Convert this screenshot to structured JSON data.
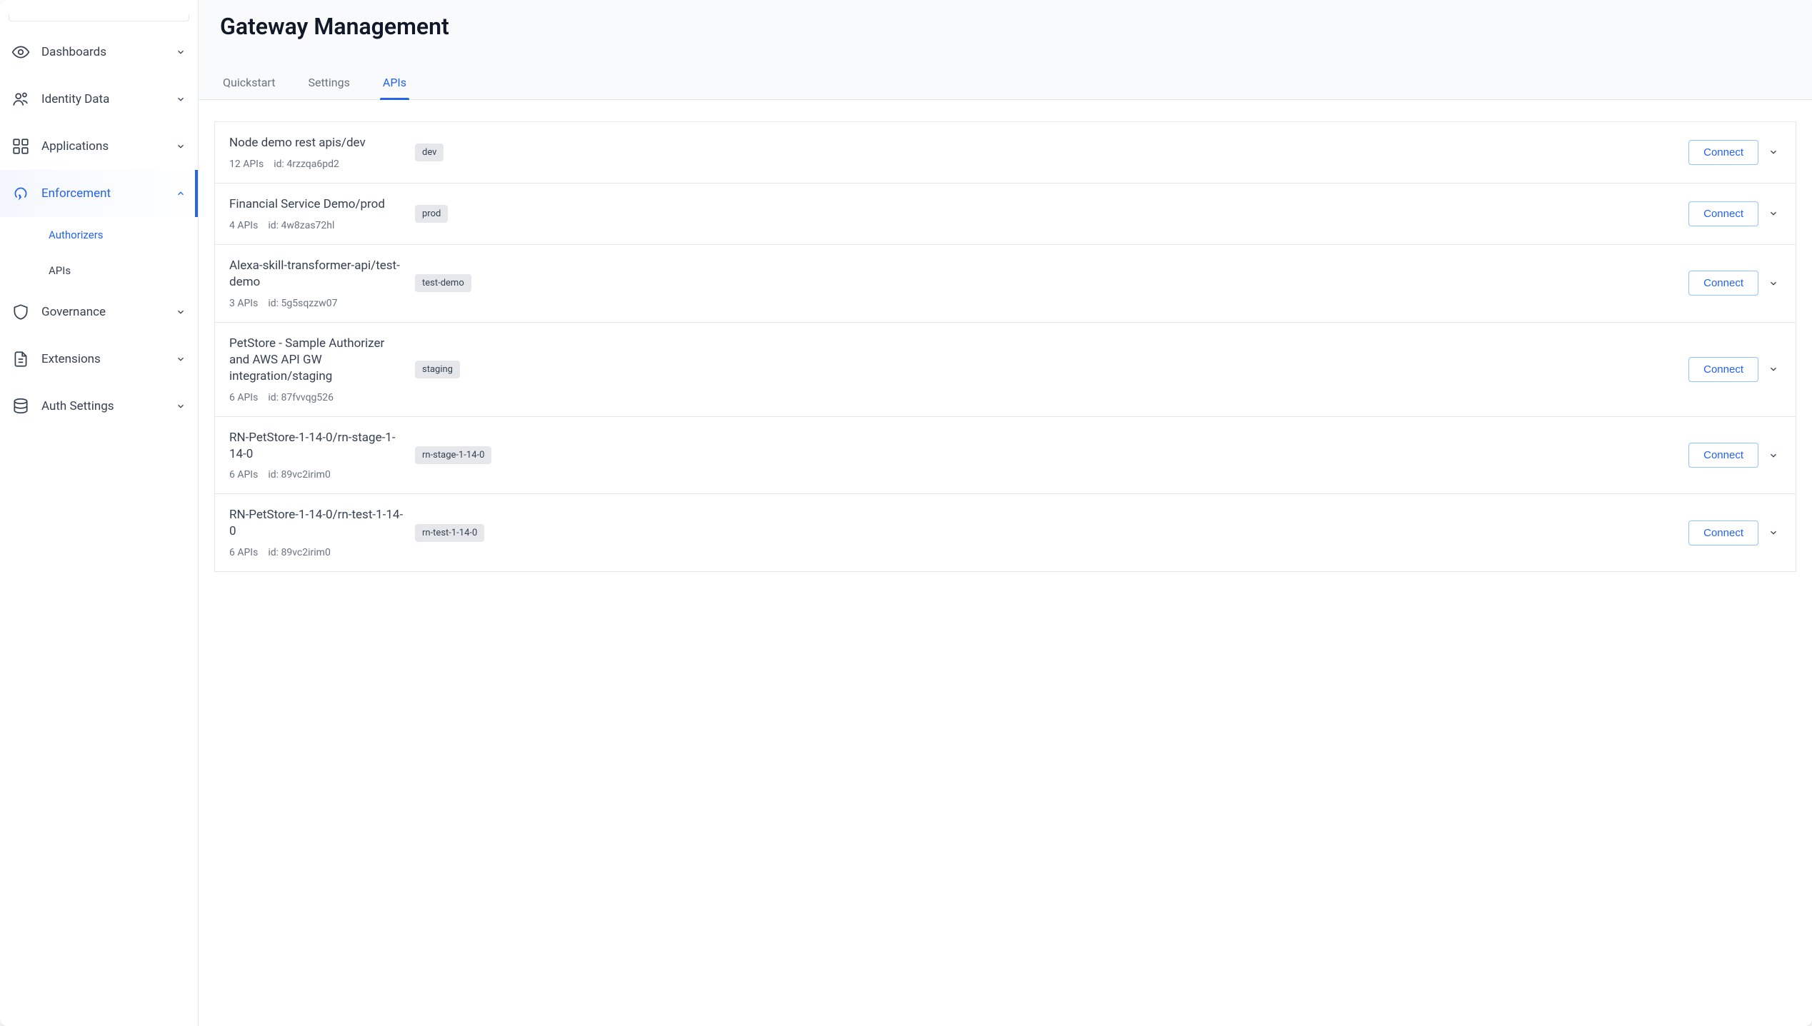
{
  "sidebar": {
    "items": [
      {
        "key": "dashboards",
        "label": "Dashboards",
        "icon": "eye",
        "expanded": false,
        "active": false
      },
      {
        "key": "identity",
        "label": "Identity Data",
        "icon": "identity",
        "expanded": false,
        "active": false
      },
      {
        "key": "applications",
        "label": "Applications",
        "icon": "apps",
        "expanded": false,
        "active": false
      },
      {
        "key": "enforcement",
        "label": "Enforcement",
        "icon": "enforcement",
        "expanded": true,
        "active": true,
        "children": [
          {
            "key": "authorizers",
            "label": "Authorizers",
            "active": true
          },
          {
            "key": "apis",
            "label": "APIs",
            "active": false
          }
        ]
      },
      {
        "key": "governance",
        "label": "Governance",
        "icon": "shield",
        "expanded": false,
        "active": false
      },
      {
        "key": "extensions",
        "label": "Extensions",
        "icon": "document",
        "expanded": false,
        "active": false
      },
      {
        "key": "authsettings",
        "label": "Auth Settings",
        "icon": "database",
        "expanded": false,
        "active": false
      }
    ]
  },
  "page": {
    "title": "Gateway Management",
    "tabs": [
      {
        "key": "quickstart",
        "label": "Quickstart",
        "active": false
      },
      {
        "key": "settings",
        "label": "Settings",
        "active": false
      },
      {
        "key": "apis",
        "label": "APIs",
        "active": true
      }
    ],
    "connect_label": "Connect",
    "id_prefix": "id: ",
    "apis_suffix": " APIs"
  },
  "rows": [
    {
      "title": "Node demo rest apis/dev",
      "api_count": 12,
      "id": "4rzzqa6pd2",
      "tag": "dev"
    },
    {
      "title": "Financial Service Demo/prod",
      "api_count": 4,
      "id": "4w8zas72hl",
      "tag": "prod"
    },
    {
      "title": "Alexa-skill-transformer-api/test-demo",
      "api_count": 3,
      "id": "5g5sqzzw07",
      "tag": "test-demo"
    },
    {
      "title": "PetStore - Sample Authorizer and AWS API GW integration/staging",
      "api_count": 6,
      "id": "87fvvqg526",
      "tag": "staging"
    },
    {
      "title": "RN-PetStore-1-14-0/rn-stage-1-14-0",
      "api_count": 6,
      "id": "89vc2irim0",
      "tag": "rn-stage-1-14-0"
    },
    {
      "title": "RN-PetStore-1-14-0/rn-test-1-14-0",
      "api_count": 6,
      "id": "89vc2irim0",
      "tag": "rn-test-1-14-0"
    }
  ]
}
